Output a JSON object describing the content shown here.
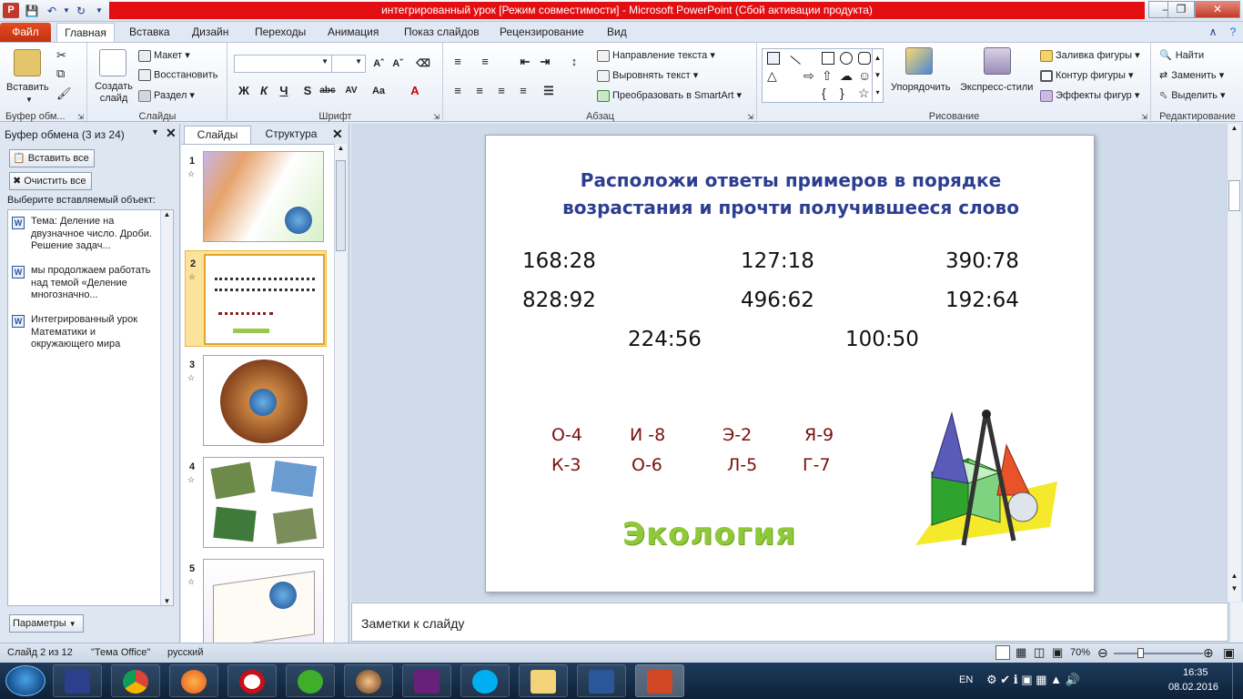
{
  "window": {
    "title": "интегрированный урок [Режим совместимости]  -  Microsoft PowerPoint (Сбой активации продукта)",
    "minimize": "–",
    "maximize": "❐",
    "close": "✕"
  },
  "tabs": [
    "Файл",
    "Главная",
    "Вставка",
    "Дизайн",
    "Переходы",
    "Анимация",
    "Показ слайдов",
    "Рецензирование",
    "Вид"
  ],
  "ribbon": {
    "clipboard": {
      "label": "Буфер обм...",
      "paste": "Вставить"
    },
    "slides": {
      "label": "Слайды",
      "new_slide": "Создать слайд",
      "layout": "Макет",
      "reset": "Восстановить",
      "section": "Раздел"
    },
    "font": {
      "label": "Шрифт",
      "font_name": "",
      "font_size": ""
    },
    "paragraph": {
      "label": "Абзац",
      "text_direction": "Направление текста",
      "align_text": "Выровнять текст",
      "smartart": "Преобразовать в SmartArt"
    },
    "drawing": {
      "label": "Рисование",
      "arrange": "Упорядочить",
      "quick_styles": "Экспресс-стили",
      "fill": "Заливка фигуры",
      "outline": "Контур фигуры",
      "effects": "Эффекты фигур"
    },
    "editing": {
      "label": "Редактирование",
      "find": "Найти",
      "replace": "Заменить",
      "select": "Выделить"
    }
  },
  "clipboard_pane": {
    "title": "Буфер обмена (3 из 24)",
    "paste_all": "Вставить все",
    "clear_all": "Очистить все",
    "prompt": "Выберите вставляемый объект:",
    "items": [
      "Тема: Деление на двузначное число. Дроби. Решение задач...",
      "мы продолжаем работать над темой «Деление многозначно...",
      "Интегрированный урок Математики и окружающего мира"
    ],
    "options": "Параметры"
  },
  "slides_pane": {
    "tab_slides": "Слайды",
    "tab_outline": "Структура",
    "numbers": [
      "1",
      "2",
      "3",
      "4",
      "5"
    ],
    "selected": "2"
  },
  "slide": {
    "title_line1": "Расположи ответы примеров  в порядке",
    "title_line2": "возрастания и прочти получившееся слово",
    "expressions": [
      "168:28",
      "127:18",
      "390:78",
      "828:92",
      "496:62",
      "192:64",
      "224:56",
      "100:50"
    ],
    "codes": [
      "О-4",
      "И -8",
      "Э-2",
      "Я-9",
      "К-3",
      "О-6",
      "Л-5",
      "Г-7"
    ],
    "answer": "Экология"
  },
  "notes_placeholder": "Заметки к слайду",
  "status": {
    "slide_info": "Слайд 2 из 12",
    "theme": "\"Тема Office\"",
    "language": "русский",
    "zoom": "70%"
  },
  "taskbar": {
    "lang": "EN",
    "time": "16:35",
    "date": "08.02.2016"
  },
  "colors": {
    "title_bar_red": "#e30e12",
    "file_tab": "#d04a1e",
    "slide_title": "#2c3e90",
    "code_text": "#7a0f0f",
    "answer_green": "#8fc93a"
  }
}
